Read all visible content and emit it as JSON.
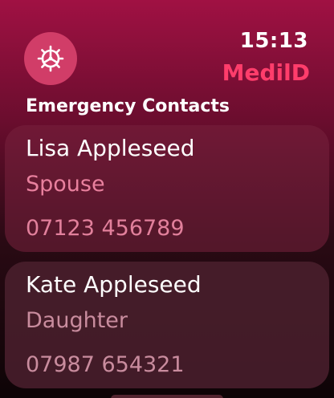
{
  "header": {
    "time": "15:13",
    "app_title": "MedilD",
    "settings_icon": "gear-icon"
  },
  "section": {
    "title": "Emergency Contacts"
  },
  "contacts": [
    {
      "name": "Lisa Appleseed",
      "relation": "Spouse",
      "phone": "07123 456789"
    },
    {
      "name": "Kate Appleseed",
      "relation": "Daughter",
      "phone": "07987 654321"
    }
  ],
  "colors": {
    "accent": "#ff3d6b",
    "settings_button": "#d13d68",
    "secondary_text_active": "#e9809e",
    "secondary_text": "#c98c9e"
  }
}
